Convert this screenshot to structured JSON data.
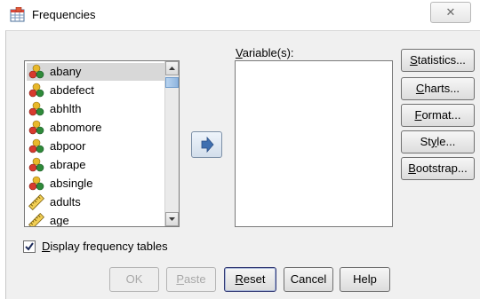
{
  "window": {
    "title": "Frequencies",
    "close_glyph": "✕",
    "icon": "spss-frequencies-icon"
  },
  "source_list": {
    "selected_index": 0,
    "items": [
      {
        "label": "abany",
        "icon": "nominal-icon"
      },
      {
        "label": "abdefect",
        "icon": "nominal-icon"
      },
      {
        "label": "abhlth",
        "icon": "nominal-icon"
      },
      {
        "label": "abnomore",
        "icon": "nominal-icon"
      },
      {
        "label": "abpoor",
        "icon": "nominal-icon"
      },
      {
        "label": "abrape",
        "icon": "nominal-icon"
      },
      {
        "label": "absingle",
        "icon": "nominal-icon"
      },
      {
        "label": "adults",
        "icon": "scale-icon"
      },
      {
        "label": "age",
        "icon": "scale-icon"
      }
    ]
  },
  "target": {
    "label_mnemonic": "V",
    "label_rest": "ariable(s):"
  },
  "side_buttons": [
    {
      "mn": "S",
      "rest": "tatistics..."
    },
    {
      "mn": "C",
      "rest": "harts..."
    },
    {
      "mn": "F",
      "rest": "ormat..."
    },
    {
      "pre": "St",
      "mn": "y",
      "rest": "le..."
    },
    {
      "mn": "B",
      "rest": "ootstrap..."
    }
  ],
  "display_tables": {
    "checked": true,
    "mn": "D",
    "rest": "isplay frequency tables"
  },
  "bottom_buttons": {
    "ok": "OK",
    "paste_mn": "P",
    "paste_rest": "aste",
    "reset_mn": "R",
    "reset_rest": "eset",
    "cancel": "Cancel",
    "help": "Help"
  }
}
